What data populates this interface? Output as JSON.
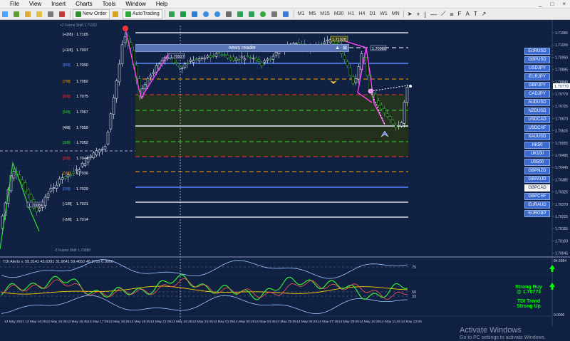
{
  "menu": {
    "items": [
      "File",
      "View",
      "Insert",
      "Charts",
      "Tools",
      "Window",
      "Help"
    ],
    "window_controls": [
      "_",
      "□",
      "×"
    ]
  },
  "toolbar": {
    "new_order": "New Order",
    "autotrading": "AutoTrading",
    "timeframes": [
      "M1",
      "M5",
      "M15",
      "M30",
      "H1",
      "H4",
      "D1",
      "W1",
      "MN"
    ]
  },
  "news_reader": {
    "label": "news reader"
  },
  "murrey": {
    "top_label": "+2 Frame Shift 1.71102",
    "bottom_label": "-2 Frame Shift 1.70980",
    "levels": [
      {
        "label": "[+2/8]",
        "price": "1.7105",
        "color": "#ffffff"
      },
      {
        "label": "[+1/8]",
        "price": "1.7097",
        "color": "#ffffff"
      },
      {
        "label": "[8/8]",
        "price": "1.7090",
        "color": "#5b86ff"
      },
      {
        "label": "[7/8]",
        "price": "1.7082",
        "color": "#ffa500"
      },
      {
        "label": "[6/8]",
        "price": "1.7075",
        "color": "#ff3333"
      },
      {
        "label": "[5/8]",
        "price": "1.7067",
        "color": "#33dd33"
      },
      {
        "label": "[4/8]",
        "price": "1.7059",
        "color": "#ffffff"
      },
      {
        "label": "[3/8]",
        "price": "1.7052",
        "color": "#33dd33"
      },
      {
        "label": "[2/8]",
        "price": "1.7044",
        "color": "#ff3333"
      },
      {
        "label": "[1/8]",
        "price": "1.7036",
        "color": "#ffa500"
      },
      {
        "label": "[0/8]",
        "price": "1.7029",
        "color": "#5b86ff"
      },
      {
        "label": "[-1/8]",
        "price": "1.7021",
        "color": "#ffffff"
      },
      {
        "label": "[-2/8]",
        "price": "1.7014",
        "color": "#ffffff"
      }
    ]
  },
  "price_axis": {
    "labels": [
      "1.71065",
      "1.71015",
      "1.70950",
      "1.70895",
      "1.70840",
      "1.70779",
      "1.70725",
      "1.70670",
      "1.70615",
      "1.70555",
      "1.70495",
      "1.70440",
      "1.70385",
      "1.70325",
      "1.70270",
      "1.70215",
      "1.70155",
      "1.70100",
      "1.70045"
    ],
    "current": "1.70779"
  },
  "zz_labels": [
    "1.70927",
    "1.71028",
    "1.70980",
    "1.70084"
  ],
  "tdi": {
    "header": "TDI Alerts v. 55.3141 43.6391 31.9641 59.4650 48.3705 0.0000",
    "levels": [
      "75",
      "50",
      "33"
    ],
    "axis_top": "84.6984",
    "axis_bottom": "0.0000"
  },
  "signals": {
    "line1": "Strong Buy",
    "line2": "@ 1.70773",
    "line3": "TDI Trend",
    "line4": "Strong Up"
  },
  "time_axis": {
    "labels": [
      "13 May 2021",
      "13 May 14:25",
      "13 May 15:45",
      "13 May 15:45",
      "13 May 17:05",
      "13 May 18:25",
      "13 May 19:45",
      "13 May 21:05",
      "13 May 22:25",
      "13 May 23:45",
      "14 May 01:05",
      "14 May 02:25",
      "14 May 03:45",
      "14 May 05:05",
      "14 May 06:25",
      "14 May 07:45",
      "14 May 09:05",
      "14 May 10:25",
      "14 May 11:45",
      "14 May 13:05"
    ]
  },
  "pairs": {
    "items": [
      "EURUSD",
      "GBPUSD",
      "USDJPY",
      "EURJPY",
      "GBPJPY",
      "CADJPY",
      "AUDUSD",
      "NZDUSD",
      "USDCAD",
      "USDCHF",
      "XAUUSD",
      "HK50",
      "UK100",
      "US500",
      "GBPNZD",
      "GBPAUD",
      "GBPCAD",
      "GBPCHF",
      "EURAUD",
      "EURGBP"
    ],
    "selected": "GBPCAD"
  },
  "watermark": {
    "line1": "Activate Windows",
    "line2": "Go to PC settings to activate Windows."
  }
}
